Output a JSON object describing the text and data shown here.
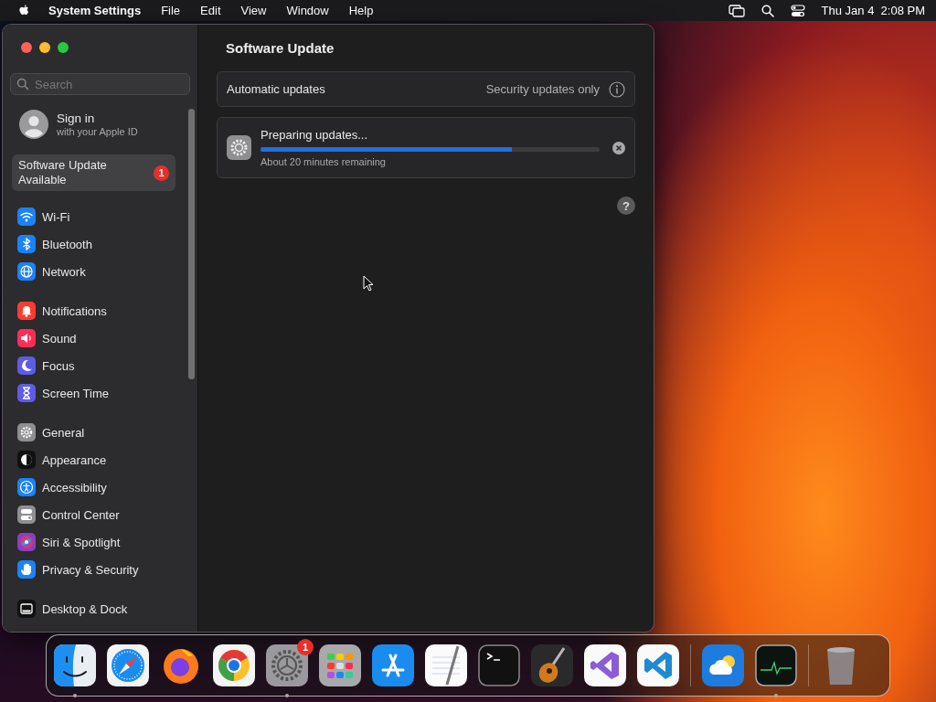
{
  "menubar": {
    "app": "System Settings",
    "menus": [
      "File",
      "Edit",
      "View",
      "Window",
      "Help"
    ],
    "clock": "Thu Jan 4  2:08 PM"
  },
  "window": {
    "sidebar": {
      "search": {
        "placeholder": "Search"
      },
      "account": {
        "title": "Sign in",
        "subtitle": "with your Apple ID"
      },
      "update_banner": {
        "label": "Software Update Available",
        "badge": "1"
      },
      "groups": [
        {
          "items": [
            {
              "label": "Wi-Fi",
              "kind": "wifi",
              "color": "#1a82fb",
              "selected": false
            },
            {
              "label": "Bluetooth",
              "kind": "bluetooth",
              "color": "#1a82fb",
              "selected": false
            },
            {
              "label": "Network",
              "kind": "network",
              "color": "#1a82fb",
              "selected": false
            }
          ]
        },
        {
          "items": [
            {
              "label": "Notifications",
              "kind": "notifications",
              "color": "#ff3b30",
              "selected": false
            },
            {
              "label": "Sound",
              "kind": "sound",
              "color": "#ff2d55",
              "selected": false
            },
            {
              "label": "Focus",
              "kind": "focus",
              "color": "#5e5ce6",
              "selected": false
            },
            {
              "label": "Screen Time",
              "kind": "screentime",
              "color": "#5e5ce6",
              "selected": false
            }
          ]
        },
        {
          "items": [
            {
              "label": "General",
              "kind": "general",
              "color": "#8e8e93",
              "selected": false
            },
            {
              "label": "Appearance",
              "kind": "appearance",
              "color": "#111111",
              "selected": false
            },
            {
              "label": "Accessibility",
              "kind": "accessibility",
              "color": "#1a82fb",
              "selected": false
            },
            {
              "label": "Control Center",
              "kind": "controlcenter",
              "color": "#8e8e93",
              "selected": false
            },
            {
              "label": "Siri & Spotlight",
              "kind": "siri",
              "color": "#8a3fc0",
              "selected": false
            },
            {
              "label": "Privacy & Security",
              "kind": "privacy",
              "color": "#1a82fb",
              "selected": false
            }
          ]
        },
        {
          "items": [
            {
              "label": "Desktop & Dock",
              "kind": "dock",
              "color": "#111111",
              "selected": false
            }
          ]
        }
      ]
    },
    "content": {
      "title": "Software Update",
      "automatic_updates": {
        "label": "Automatic updates",
        "value": "Security updates only"
      },
      "progress": {
        "title": "Preparing updates...",
        "level": 0.74,
        "status": "About 20 minutes remaining"
      },
      "help_button": "?"
    }
  },
  "dock": {
    "items": [
      {
        "kind": "finder",
        "running": true
      },
      {
        "kind": "safari",
        "running": false
      },
      {
        "kind": "firefox",
        "running": false
      },
      {
        "kind": "chrome",
        "running": false
      },
      {
        "kind": "settings",
        "running": true,
        "badge": "1"
      },
      {
        "kind": "launchpad",
        "running": false
      },
      {
        "kind": "appstore",
        "running": false
      },
      {
        "kind": "textedit",
        "running": false
      },
      {
        "kind": "terminal",
        "running": false
      },
      {
        "kind": "garageband",
        "running": false
      },
      {
        "kind": "visualstudio",
        "running": false
      },
      {
        "kind": "vscode",
        "running": false
      },
      {
        "kind": "separator"
      },
      {
        "kind": "weather",
        "running": false
      },
      {
        "kind": "activitymonitor",
        "running": true
      },
      {
        "kind": "separator"
      },
      {
        "kind": "trash",
        "running": false
      }
    ]
  }
}
